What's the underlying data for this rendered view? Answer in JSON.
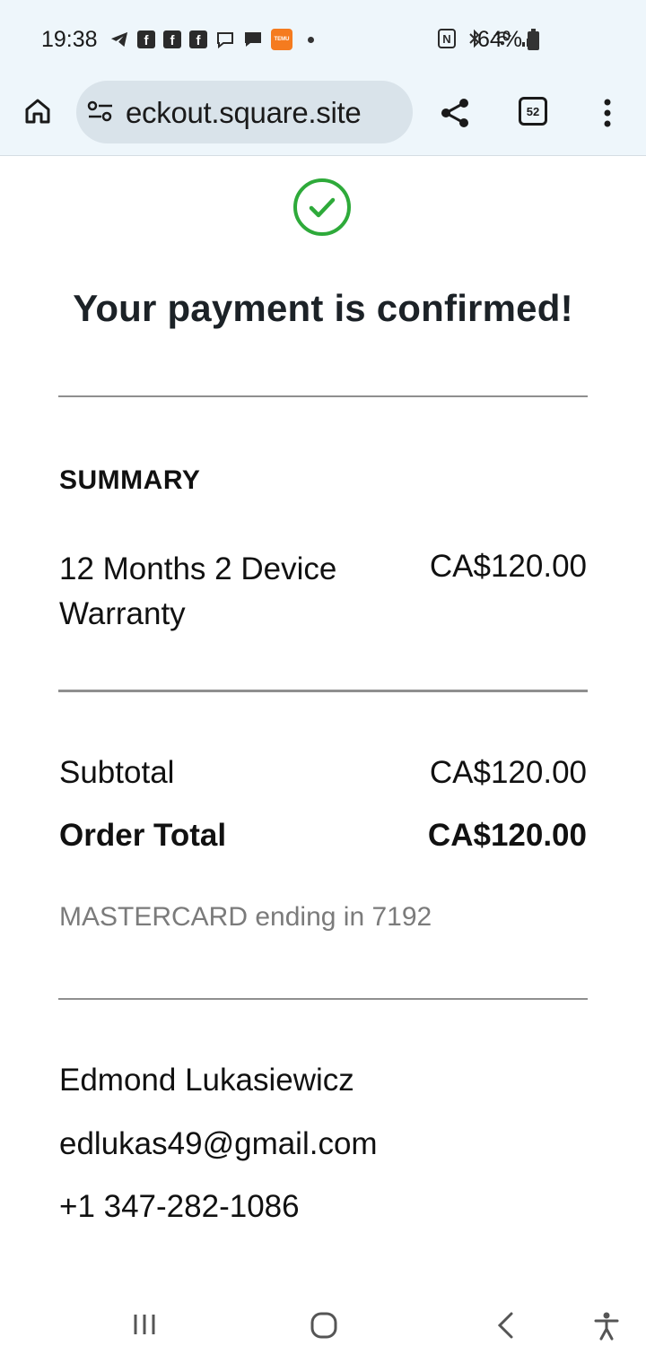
{
  "status_bar": {
    "time": "19:38",
    "battery": "64%",
    "left_icons": [
      "telegram-icon",
      "facebook-icon",
      "facebook-icon",
      "facebook-icon",
      "chat-bubble-icon",
      "message-icon",
      "temu-app-icon",
      "dot-icon"
    ],
    "temu_label": "TEMU",
    "right_icons": [
      "nfc-icon",
      "bluetooth-icon",
      "wifi-icon",
      "signal-icon",
      "battery-icon"
    ],
    "fb_letter": "f",
    "nfc_letter": "N"
  },
  "browser": {
    "url": "eckout.square.site",
    "tab_count": "52"
  },
  "confirmation": {
    "title": "Your payment is confirmed!",
    "accent_color": "#2eaa3a"
  },
  "summary": {
    "label": "SUMMARY",
    "item_name": "12 Months 2 Device Warranty",
    "item_price": "CA$120.00",
    "subtotal_label": "Subtotal",
    "subtotal_value": "CA$120.00",
    "total_label": "Order Total",
    "total_value": "CA$120.00",
    "card_info": "MASTERCARD ending in 7192"
  },
  "customer": {
    "name": "Edmond Lukasiewicz",
    "email": "edlukas49@gmail.com",
    "phone": "+1 347-282-1086"
  }
}
